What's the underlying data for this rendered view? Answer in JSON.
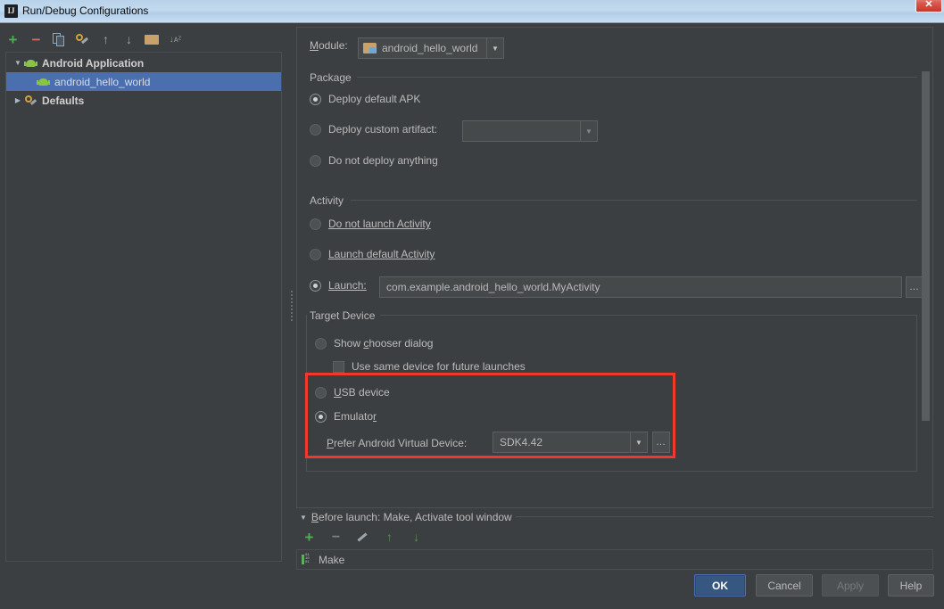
{
  "window": {
    "title": "Run/Debug Configurations",
    "app_icon": "IJ",
    "close_label": "✕"
  },
  "toolbar": {
    "buttons": [
      {
        "name": "add-configuration",
        "icon": "plus-icon",
        "glyph": "+"
      },
      {
        "name": "remove-configuration",
        "icon": "minus-icon",
        "glyph": "−"
      },
      {
        "name": "copy-configuration",
        "icon": "copy-icon",
        "glyph": ""
      },
      {
        "name": "edit-defaults",
        "icon": "wrench-icon",
        "glyph": ""
      },
      {
        "name": "move-up",
        "icon": "arrow-up-icon",
        "glyph": "↑"
      },
      {
        "name": "move-down",
        "icon": "arrow-down-icon",
        "glyph": "↓"
      },
      {
        "name": "move-into-folder",
        "icon": "folder-icon",
        "glyph": ""
      },
      {
        "name": "sort-configurations",
        "icon": "sort-az-icon",
        "glyph": "↓ᴀᶻ"
      }
    ]
  },
  "tree": {
    "items": [
      {
        "label": "Android Application",
        "twisty": "▼",
        "icon": "android-icon",
        "selected": false,
        "child": false
      },
      {
        "label": "android_hello_world",
        "twisty": "",
        "icon": "android-icon",
        "selected": true,
        "child": true
      },
      {
        "label": "Defaults",
        "twisty": "▶",
        "icon": "wrench-gear-icon",
        "selected": false,
        "child": false
      }
    ]
  },
  "settings": {
    "module": {
      "label": "Module:",
      "label_mnemonic": "M",
      "value": "android_hello_world",
      "arrow": "▼"
    },
    "package_group": {
      "title": "Package",
      "options": [
        {
          "label": "Deploy default APK",
          "checked": true
        },
        {
          "label": "Deploy custom artifact:",
          "checked": false
        },
        {
          "label": "Do not deploy anything",
          "checked": false
        }
      ],
      "artifact_value": "",
      "artifact_arrow": "▼"
    },
    "activity_group": {
      "title": "Activity",
      "options": [
        {
          "label": "Do not launch Activity",
          "checked": false
        },
        {
          "label": "Launch default Activity",
          "checked": false
        },
        {
          "label": "Launch:",
          "checked": true
        }
      ],
      "launch_value": "com.example.android_hello_world.MyActivity",
      "browse_label": "…"
    },
    "target_device_group": {
      "title": "Target Device",
      "show_chooser": {
        "label": "Show chooser dialog",
        "checked": false
      },
      "use_same_device": {
        "label": "Use same device for future launches",
        "checked": false
      },
      "usb_device": {
        "label": "USB device",
        "checked": false
      },
      "emulator": {
        "label": "Emulator",
        "checked": true
      },
      "avd": {
        "label": "Prefer Android Virtual Device:",
        "value": "SDK4.42",
        "arrow": "▼",
        "browse_label": "…"
      }
    }
  },
  "before_launch": {
    "header": "Before launch: Make, Activate tool window",
    "collapse_arrow": "▼",
    "toolbar": [
      {
        "name": "add-task",
        "icon": "plus-icon",
        "glyph": "+"
      },
      {
        "name": "remove-task",
        "icon": "minus-icon",
        "glyph": "−"
      },
      {
        "name": "edit-task",
        "icon": "pencil-icon",
        "glyph": ""
      },
      {
        "name": "move-task-up",
        "icon": "arrow-up-icon",
        "glyph": "↑"
      },
      {
        "name": "move-task-down",
        "icon": "arrow-down-icon",
        "glyph": "↓"
      }
    ],
    "tasks": [
      {
        "label": "Make",
        "icon": "make-icon"
      }
    ]
  },
  "buttons": {
    "ok": "OK",
    "cancel": "Cancel",
    "apply": "Apply",
    "help": "Help"
  },
  "colors": {
    "accent_blue": "#4b6eaf",
    "ok_button": "#365880",
    "highlight_red": "#f0392b",
    "panel_bg": "#3c3f41",
    "titlebar_blue": "#b8d2ea"
  }
}
